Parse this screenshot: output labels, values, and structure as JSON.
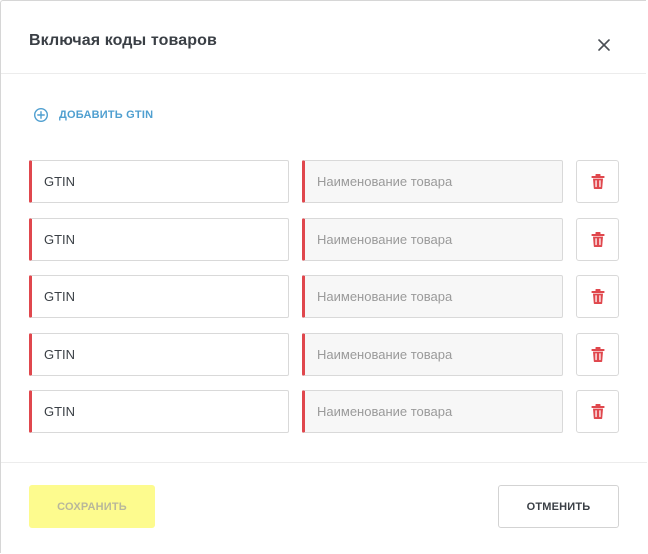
{
  "modal": {
    "title": "Включая коды товаров",
    "close_icon": "close-icon"
  },
  "add_gtin": {
    "label": "ДОБАВИТЬ GTIN",
    "icon": "plus-circle-icon",
    "color": "#4f9fd0"
  },
  "rows": [
    {
      "gtin_placeholder": "GTIN",
      "gtin_value": "",
      "name_placeholder": "Наименование товара",
      "name_value": "",
      "delete_icon": "trash-icon"
    },
    {
      "gtin_placeholder": "GTIN",
      "gtin_value": "",
      "name_placeholder": "Наименование товара",
      "name_value": "",
      "delete_icon": "trash-icon"
    },
    {
      "gtin_placeholder": "GTIN",
      "gtin_value": "",
      "name_placeholder": "Наименование товара",
      "name_value": "",
      "delete_icon": "trash-icon"
    },
    {
      "gtin_placeholder": "GTIN",
      "gtin_value": "",
      "name_placeholder": "Наименование товара",
      "name_value": "",
      "delete_icon": "trash-icon"
    },
    {
      "gtin_placeholder": "GTIN",
      "gtin_value": "",
      "name_placeholder": "Наименование товара",
      "name_value": "",
      "delete_icon": "trash-icon"
    }
  ],
  "footer": {
    "save_label": "СОХРАНИТЬ",
    "save_enabled": false,
    "cancel_label": "ОТМЕНИТЬ"
  },
  "colors": {
    "error_border": "#e0474d",
    "save_bg": "#fdfb8e",
    "delete_icon": "#e0474d"
  }
}
